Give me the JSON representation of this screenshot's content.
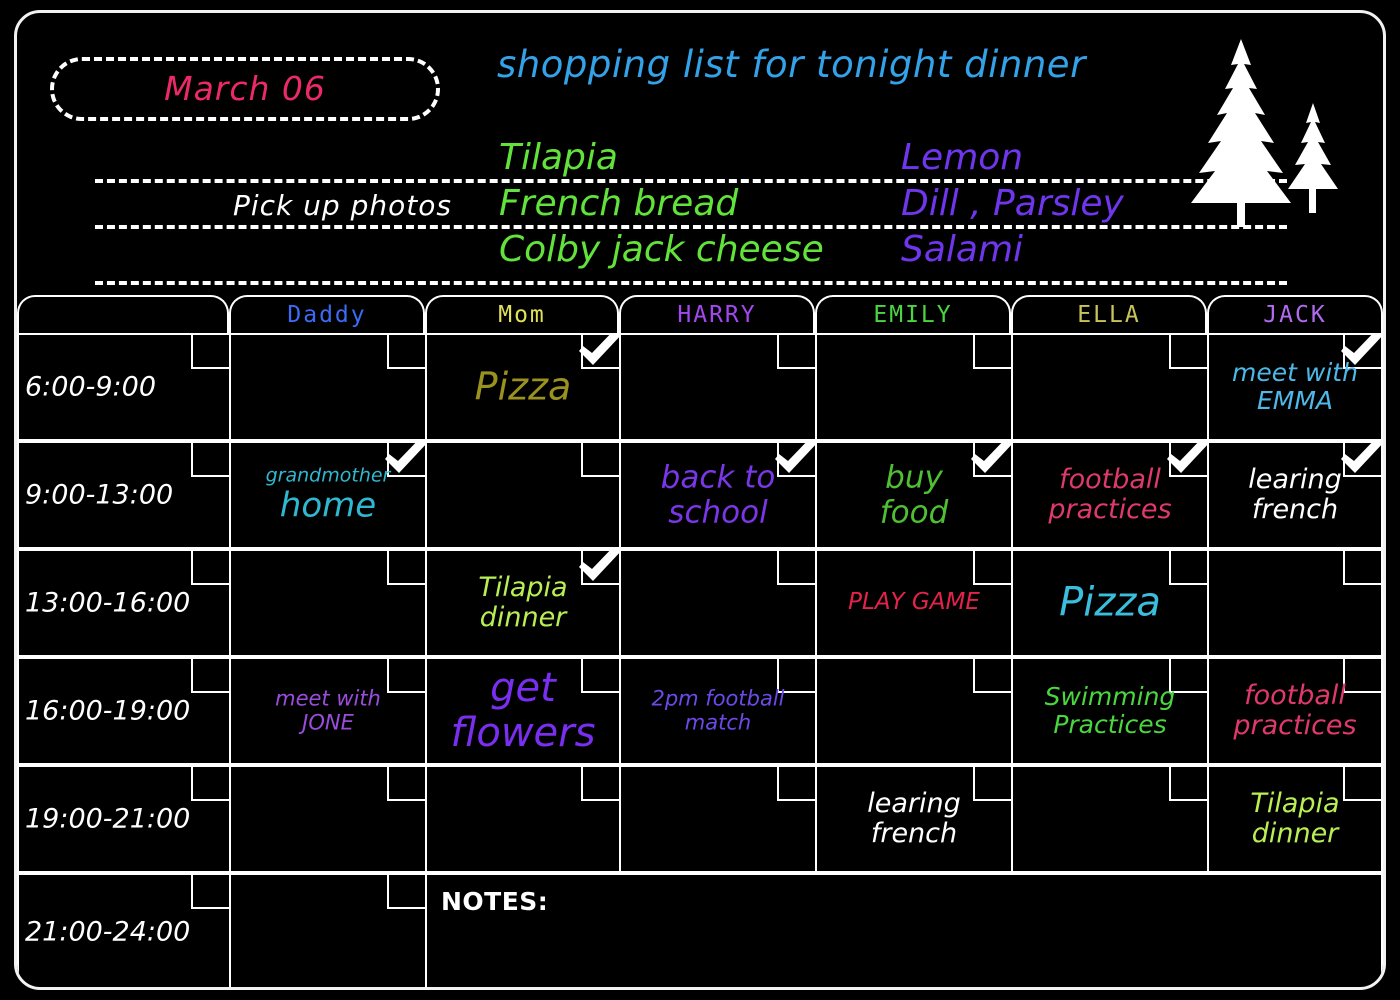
{
  "board": {
    "date_label": "March 06",
    "date_color": "#ec2a67",
    "shopping_title": "shopping list for tonight dinner",
    "shopping_title_color": "#33a2e8",
    "pickup_note": "Pick up photos",
    "shopping_col_a": [
      "Tilapia",
      "French bread",
      "Colby jack cheese"
    ],
    "shopping_col_b": [
      "Lemon",
      "Dill , Parsley",
      "Salami"
    ],
    "shopping_col_a_color": "#62e33c",
    "shopping_col_b_color": "#6f36ee",
    "tree_icon": "pine-trees-icon",
    "notes_label": "NOTES:"
  },
  "columns": [
    {
      "label": "",
      "color": "#ffffff"
    },
    {
      "label": "Daddy",
      "color": "#3b6bf5"
    },
    {
      "label": "Mom",
      "color": "#e0e05a"
    },
    {
      "label": "HARRY",
      "color": "#a347ef"
    },
    {
      "label": "EMILY",
      "color": "#4ad63f"
    },
    {
      "label": "ELLA",
      "color": "#c9c45a"
    },
    {
      "label": "JACK",
      "color": "#b06bf0"
    }
  ],
  "time_slots": [
    "6:00-9:00",
    "9:00-13:00",
    "13:00-16:00",
    "16:00-19:00",
    "19:00-21:00",
    "21:00-24:00"
  ],
  "entries": {
    "r0c2": {
      "l1": "Pizza",
      "l2": "",
      "color": "#9a9120",
      "size": 38,
      "checked": true
    },
    "r0c6": {
      "l1": "meet with",
      "l2": "EMMA",
      "color": "#4fb8e8",
      "size": 25,
      "checked": true
    },
    "r1c1": {
      "l1": "grandmother",
      "l2": "home",
      "color": "#2fb8cf",
      "size": 19,
      "size2": 34,
      "checked": true
    },
    "r1c3": {
      "l1": "back to",
      "l2": "school",
      "color": "#7a36e8",
      "size": 31,
      "checked": true
    },
    "r1c4": {
      "l1": "buy",
      "l2": "food",
      "color": "#4fbf34",
      "size": 31,
      "checked": true
    },
    "r1c5": {
      "l1": "football",
      "l2": "practices",
      "color": "#e0396b",
      "size": 27,
      "checked": true
    },
    "r1c6": {
      "l1": "learing",
      "l2": "french",
      "color": "#ffffff",
      "size": 27,
      "checked": true
    },
    "r2c2": {
      "l1": "Tilapia",
      "l2": "dinner",
      "color": "#b9ef54",
      "size": 27,
      "checked": true
    },
    "r2c4": {
      "l1": "PLAY GAME",
      "l2": "",
      "color": "#e5224a",
      "size": 23,
      "checked": false
    },
    "r2c5": {
      "l1": "Pizza",
      "l2": "",
      "color": "#3bbede",
      "size": 40,
      "checked": false
    },
    "r3c1": {
      "l1": "meet with",
      "l2": "JONE",
      "color": "#9a4ddb",
      "size": 21,
      "checked": false
    },
    "r3c2": {
      "l1": "get",
      "l2": "flowers",
      "color": "#7a2ef0",
      "size": 40,
      "checked": false
    },
    "r3c3": {
      "l1": "2pm football",
      "l2": "match",
      "color": "#6b4ae8",
      "size": 21,
      "checked": false
    },
    "r3c5": {
      "l1": "Swimming",
      "l2": "Practices",
      "color": "#4ad63f",
      "size": 25,
      "checked": false
    },
    "r3c6": {
      "l1": "football",
      "l2": "practices",
      "color": "#e0396b",
      "size": 27,
      "checked": false
    },
    "r4c4": {
      "l1": "learing",
      "l2": "french",
      "color": "#ffffff",
      "size": 27,
      "checked": false
    },
    "r4c6": {
      "l1": "Tilapia",
      "l2": "dinner",
      "color": "#b9ef54",
      "size": 27,
      "checked": false
    }
  }
}
